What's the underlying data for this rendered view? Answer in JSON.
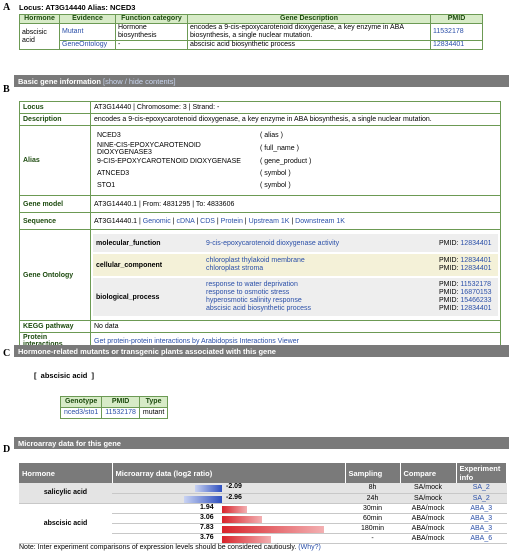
{
  "section_a": {
    "letter": "A",
    "locus_line": "Locus: AT3G14440 Alias: NCED3",
    "headers": [
      "Hormone",
      "Evidence",
      "Function category",
      "Gene Description",
      "PMID"
    ],
    "hormone": "abscisic acid",
    "rows": [
      {
        "evidence": "Mutant",
        "category": "Hormone biosynthesis",
        "description": "encodes a 9-cis-epoxycarotenoid dioxygenase, a key enzyme in ABA biosynthesis, a single nuclear mutation.",
        "pmid": "11532178"
      },
      {
        "evidence": "GeneOntology",
        "category": "-",
        "description": "abscisic acid biosynthetic process",
        "pmid": "12834401"
      }
    ]
  },
  "section_b": {
    "letter": "B",
    "title": "Basic gene information",
    "toggle": "[show / hide contents]",
    "locus_label": "Locus",
    "locus_value": "AT3G14440 | Chromosome: 3 | Strand: -",
    "description_label": "Description",
    "description_value": "encodes a 9-cis-epoxycarotenoid dioxygenase, a key enzyme in ABA biosynthesis, a single nuclear mutation.",
    "alias_label": "Alias",
    "aliases": [
      {
        "name": "NCED3",
        "type": "( alias )"
      },
      {
        "name": "NINE-CIS-EPOXYCAROTENOID DIOXYGENASE3",
        "type": "( full_name )"
      },
      {
        "name": "9-CIS-EPOXYCAROTENOID DIOXYGENASE",
        "type": "( gene_product )"
      },
      {
        "name": "ATNCED3",
        "type": "( symbol )"
      },
      {
        "name": "STO1",
        "type": "( symbol )"
      }
    ],
    "gene_model_label": "Gene model",
    "gene_model_value": "AT3G14440.1 | From: 4831295 | To: 4833606",
    "sequence_label": "Sequence",
    "sequence_prefix": "AT3G14440.1 |",
    "sequence_links": [
      "Genomic",
      "cDNA",
      "CDS",
      "Protein",
      "Upstream 1K",
      "Downstream 1K"
    ],
    "go_label": "Gene Ontology",
    "go_groups": [
      {
        "category": "molecular_function",
        "bg": "#eeeeee",
        "terms": [
          {
            "term": "9-cis-epoxycarotenoid dioxygenase activity",
            "pmid": "12834401"
          }
        ]
      },
      {
        "category": "cellular_component",
        "bg": "#f4f1d8",
        "terms": [
          {
            "term": "chloroplast thylakoid membrane",
            "pmid": "12834401"
          },
          {
            "term": "chloroplast stroma",
            "pmid": "12834401"
          }
        ]
      },
      {
        "category": "biological_process",
        "bg": "#eeeeee",
        "terms": [
          {
            "term": "response to water deprivation",
            "pmid": "11532178"
          },
          {
            "term": "response to osmotic stress",
            "pmid": "16870153"
          },
          {
            "term": "hyperosmotic salinity response",
            "pmid": "15466233"
          },
          {
            "term": "abscisic acid biosynthetic process",
            "pmid": "12834401"
          }
        ]
      }
    ],
    "pmid_prefix": "PMID:",
    "kegg_label": "KEGG pathway",
    "kegg_value": "No data",
    "ppi_label": "Protein interactions",
    "ppi_value": "Get protein-protein interactions by Arabidopsis Interactions Viewer"
  },
  "section_c": {
    "letter": "C",
    "title": "Hormone-related mutants or transgenic plants associated with this gene",
    "hormone_tag_open": "[",
    "hormone_tag": "abscisic acid",
    "hormone_tag_close": "]",
    "headers": [
      "Genotype",
      "PMID",
      "Type"
    ],
    "row": {
      "genotype": "nced3/sto1",
      "pmid": "11532178",
      "type": "mutant"
    }
  },
  "section_d": {
    "letter": "D",
    "title": "Microarray data for this gene",
    "headers": [
      "Hormone",
      "Microarray data (log2 ratio)",
      "Sampling",
      "Compare",
      "Experiment info"
    ],
    "rows": [
      {
        "hormone": "salicylic acid",
        "value": "-2.09",
        "sampling": "8h",
        "compare": "SA/mock",
        "exp": "SA_2"
      },
      {
        "hormone": "salicylic acid",
        "value": "-2.96",
        "sampling": "24h",
        "compare": "SA/mock",
        "exp": "SA_2"
      },
      {
        "hormone": "abscisic acid",
        "value": "1.94",
        "sampling": "30min",
        "compare": "ABA/mock",
        "exp": "ABA_3"
      },
      {
        "hormone": "abscisic acid",
        "value": "3.06",
        "sampling": "60min",
        "compare": "ABA/mock",
        "exp": "ABA_3"
      },
      {
        "hormone": "abscisic acid",
        "value": "7.83",
        "sampling": "180min",
        "compare": "ABA/mock",
        "exp": "ABA_3"
      },
      {
        "hormone": "abscisic acid",
        "value": "3.76",
        "sampling": "-",
        "compare": "ABA/mock",
        "exp": "ABA_6"
      }
    ],
    "hormone_sa": "salicylic acid",
    "hormone_aba": "abscisic acid",
    "note": "Note: Inter experiment comparisons of expression levels should be considered cautiously.",
    "note_link": "(Why?)",
    "colors": {
      "negative": "#2e4fbf",
      "positive": "#d8232a"
    }
  }
}
